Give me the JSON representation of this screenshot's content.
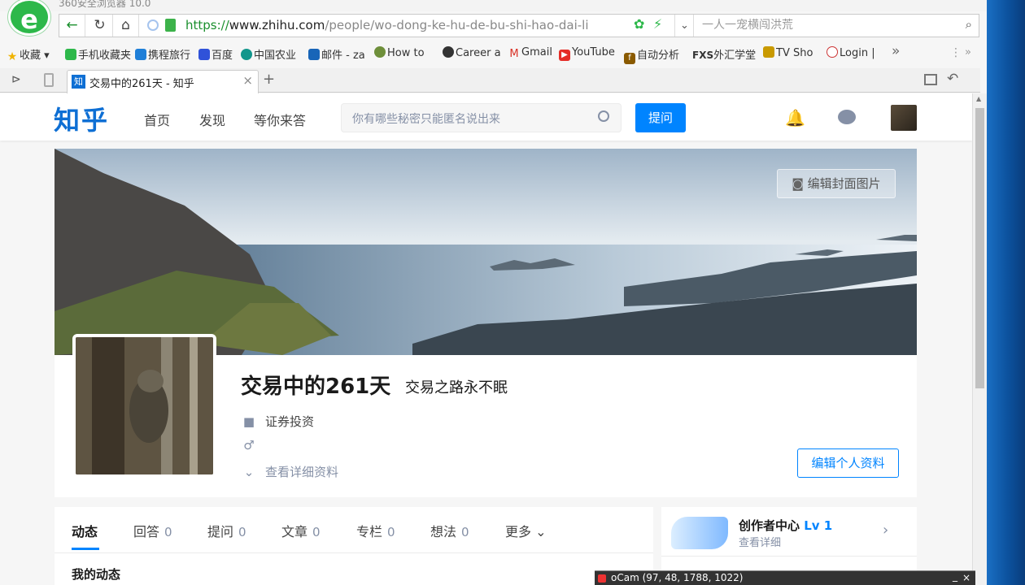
{
  "browser": {
    "title": "360安全浏览器 10.0",
    "url_scheme": "https://",
    "url_domain": "www.zhihu.com",
    "url_path": "/people/wo-dong-ke-hu-de-bu-shi-hao-dai-li",
    "search_placeholder": "一人一宠横闯洪荒",
    "logo_letter": "e"
  },
  "bookmarks": {
    "favorites": "收藏",
    "items": [
      "手机收藏夹",
      "携程旅行",
      "百度",
      "中国农业",
      "邮件 - za",
      "How to",
      "Career a",
      "Gmail",
      "YouTube",
      "自动分析",
      "外汇学堂",
      "TV Sho",
      "Login |"
    ],
    "fxs": "FXS",
    "more": "»"
  },
  "tab": {
    "favicon": "知",
    "title": "交易中的261天 - 知乎",
    "close": "×",
    "new": "+"
  },
  "zhihu": {
    "logo": "知乎",
    "nav": [
      "首页",
      "发现",
      "等你来答"
    ],
    "search_placeholder": "你有哪些秘密只能匿名说出来",
    "ask": "提问"
  },
  "profile": {
    "edit_cover": "编辑封面图片",
    "name": "交易中的261天",
    "headline": "交易之路永不眠",
    "industry": "证券投资",
    "gender_symbol": "♂",
    "details_link": "查看详细资料",
    "edit_profile": "编辑个人资料"
  },
  "tabs": [
    {
      "label": "动态",
      "count": ""
    },
    {
      "label": "回答",
      "count": "0"
    },
    {
      "label": "提问",
      "count": "0"
    },
    {
      "label": "文章",
      "count": "0"
    },
    {
      "label": "专栏",
      "count": "0"
    },
    {
      "label": "想法",
      "count": "0"
    },
    {
      "label": "更多",
      "count": ""
    }
  ],
  "feed_title": "我的动态",
  "creator": {
    "title": "创作者中心",
    "level": "Lv 1",
    "sub": "查看详细"
  },
  "overlay": {
    "text": "oCam (97, 48, 1788, 1022)",
    "min": "_",
    "close": "×"
  },
  "colors": {
    "zhihu_blue": "#0084ff",
    "browser_green": "#2db84a"
  }
}
